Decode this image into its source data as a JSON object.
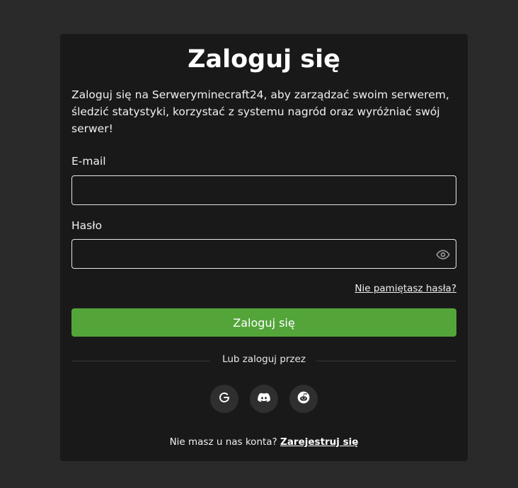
{
  "login": {
    "title": "Zaloguj się",
    "intro": "Zaloguj się na Serweryminecraft24, aby zarządzać swoim serwerem, śledzić statystyki, korzystać z systemu nagród oraz wyróżniać swój serwer!",
    "email_label": "E-mail",
    "email_value": "",
    "password_label": "Hasło",
    "password_value": "",
    "forgot_link": "Nie pamiętasz hasła?",
    "submit_label": "Zaloguj się",
    "or_text": "Lub zaloguj przez",
    "social": [
      {
        "icon": "google-icon"
      },
      {
        "icon": "discord-icon"
      },
      {
        "icon": "reddit-icon"
      }
    ],
    "no_account_text": "Nie masz u nas konta?",
    "register_link": "Zarejestruj się"
  },
  "colors": {
    "background": "#2b2a2b",
    "card": "#1a1919",
    "accent": "#53a53a",
    "social_bg": "#302f2f"
  }
}
